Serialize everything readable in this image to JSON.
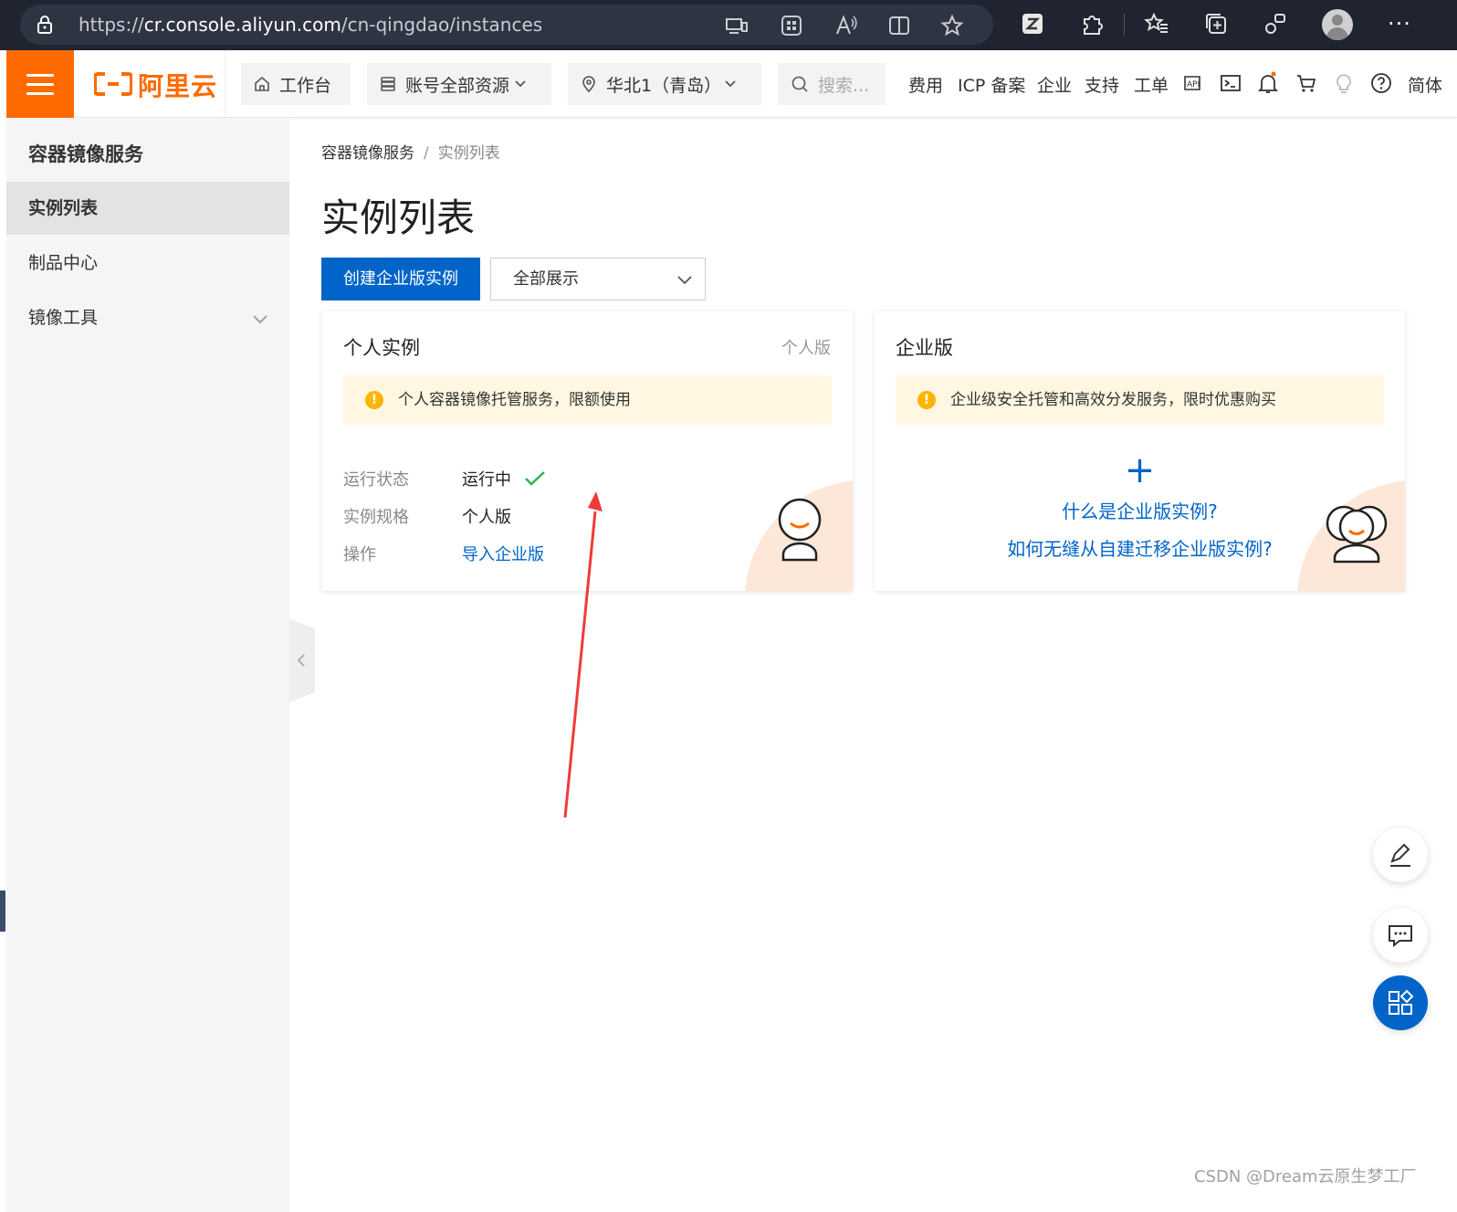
{
  "browser": {
    "url_prefix": "https://",
    "url_host": "cr.console.aliyun.com",
    "url_path": "/cn-qingdao/instances"
  },
  "topnav": {
    "logo": "阿里云",
    "workbench": "工作台",
    "resources": "账号全部资源",
    "region": "华北1（青岛）",
    "search_placeholder": "搜索...",
    "links": [
      "费用",
      "ICP 备案",
      "企业",
      "支持",
      "工单"
    ],
    "lang": "简体"
  },
  "sidebar": {
    "title": "容器镜像服务",
    "items": [
      {
        "label": "实例列表"
      },
      {
        "label": "制品中心"
      },
      {
        "label": "镜像工具"
      }
    ]
  },
  "breadcrumb": {
    "root": "容器镜像服务",
    "sep": "/",
    "current": "实例列表"
  },
  "page": {
    "title": "实例列表",
    "create_button": "创建企业版实例",
    "filter_value": "全部展示"
  },
  "personal_card": {
    "title": "个人实例",
    "tag": "个人版",
    "notice": "个人容器镜像托管服务，限额使用",
    "rows": [
      {
        "label": "运行状态",
        "value": "运行中"
      },
      {
        "label": "实例规格",
        "value": "个人版"
      },
      {
        "label": "操作",
        "value": "导入企业版"
      }
    ]
  },
  "enterprise_card": {
    "title": "企业版",
    "notice": "企业级安全托管和高效分发服务，限时优惠购买",
    "link1": "什么是企业版实例?",
    "link2": "如何无缝从自建迁移企业版实例?"
  },
  "watermark": "CSDN @Dream云原生梦工厂",
  "colors": {
    "accent": "#ff6a00",
    "primary": "#0064c8",
    "success": "#2fb44a",
    "notice_bg": "#fff7e1",
    "arrow": "#f03a3a"
  }
}
